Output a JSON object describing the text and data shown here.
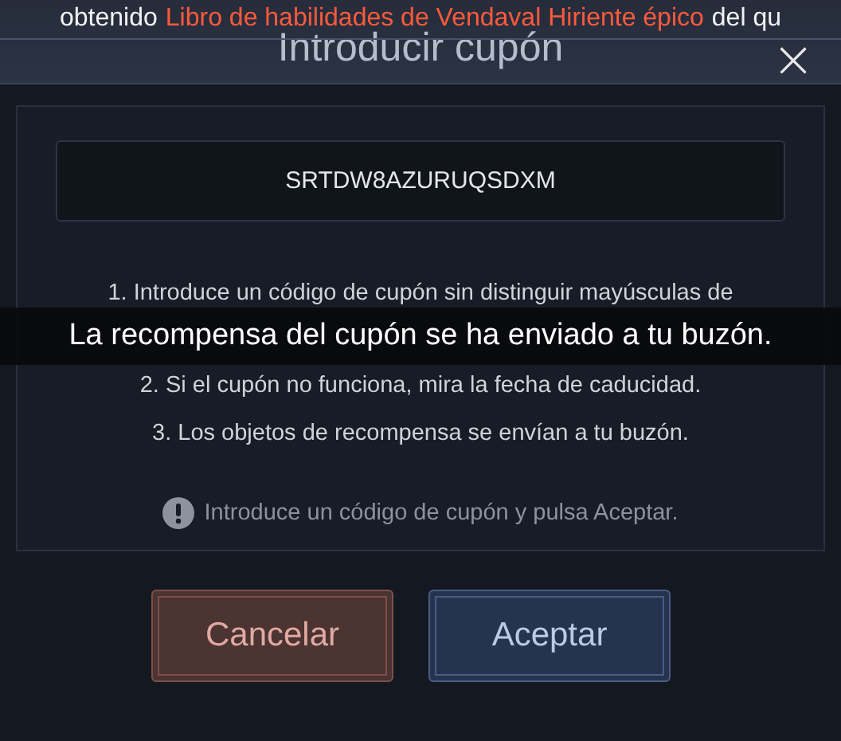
{
  "banner": {
    "segments": [
      {
        "kind": "plain",
        "text": "obtenido"
      },
      {
        "kind": "item",
        "text": "Libro de habilidades de Vendaval Hiriente épico"
      },
      {
        "kind": "plain",
        "text": "del qu"
      }
    ]
  },
  "dialog": {
    "title": "Introducir cupón",
    "close": "×",
    "coupon_field": {
      "value": "SRTDW8AZURUQSDXM"
    },
    "instructions": [
      "1. Introduce un código de cupón sin distinguir mayúsculas de",
      "2. Si el cupón no funciona, mira la fecha de caducidad.",
      "3. Los objetos de recompensa se envían a tu buzón."
    ],
    "hint": "Introduce un código de cupón y pulsa Aceptar.",
    "buttons": [
      {
        "kind": "cancel",
        "label": "Cancelar"
      },
      {
        "kind": "confirm",
        "label": "Aceptar"
      }
    ]
  },
  "toast": "La recompensa del cupón se ha enviado a tu buzón."
}
